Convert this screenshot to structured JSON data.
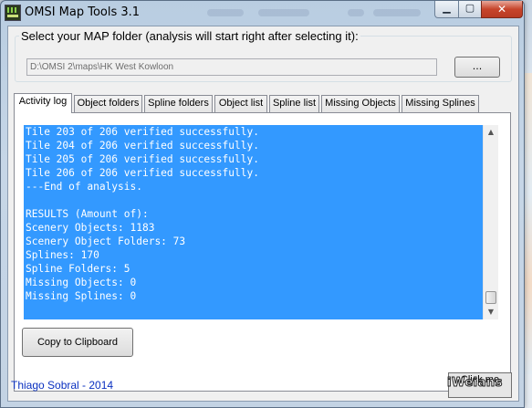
{
  "window": {
    "title": "OMSI Map Tools 3.1",
    "controls": {
      "minimize": "▁",
      "maximize": "▢",
      "close": "✕"
    }
  },
  "folder": {
    "label": "Select your MAP folder (analysis will start right after selecting it):",
    "path": "D:\\OMSI 2\\maps\\HK West Kowloon",
    "browse_label": "..."
  },
  "tabs": [
    {
      "label": "Activity log",
      "active": true
    },
    {
      "label": "Object folders"
    },
    {
      "label": "Spline folders"
    },
    {
      "label": "Object list"
    },
    {
      "label": "Spline list"
    },
    {
      "label": "Missing Objects"
    },
    {
      "label": "Missing Splines"
    }
  ],
  "log": {
    "lines": [
      "Tile 203 of 206 verified successfully.",
      "Tile 204 of 206 verified successfully.",
      "Tile 205 of 206 verified successfully.",
      "Tile 206 of 206 verified successfully.",
      "---End of analysis.",
      "",
      "RESULTS (Amount of):",
      "Scenery Objects: 1183",
      "Scenery Object Folders: 73",
      "Splines: 170",
      "Spline Folders: 5",
      "Missing Objects: 0",
      "Missing Splines: 0"
    ]
  },
  "copy_label": "Copy to Clipboard",
  "credit": "Thiago Sobral - 2014",
  "click_label": "Click me",
  "watermark": "iWeians",
  "colors": {
    "log_background": "#3399ff",
    "log_text": "#ffffff",
    "credit": "#0a30c0"
  }
}
